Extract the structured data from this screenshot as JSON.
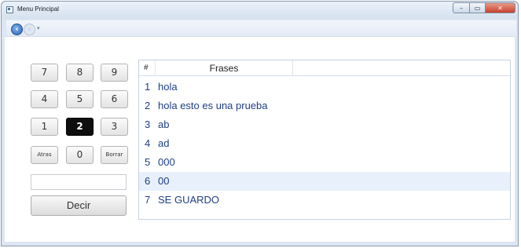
{
  "window": {
    "title": "Menu Principal",
    "controls": {
      "minimize": "–",
      "maximize": "▭",
      "close": "✕"
    }
  },
  "nav": {
    "back_icon": "back-arrow-icon",
    "forward_icon": "forward-arrow-icon",
    "dropdown": "▾"
  },
  "keypad": {
    "keys": [
      "7",
      "8",
      "9",
      "4",
      "5",
      "6",
      "1",
      "2",
      "3",
      "Atras",
      "0",
      "Borrar"
    ],
    "active_key": "2"
  },
  "input": {
    "value": ""
  },
  "decir_button": {
    "label": "Decir"
  },
  "table": {
    "headers": [
      "#",
      "Frases"
    ],
    "selected_row": 6,
    "rows": [
      {
        "num": "1",
        "text": "hola"
      },
      {
        "num": "2",
        "text": "hola esto es una prueba"
      },
      {
        "num": "3",
        "text": "ab"
      },
      {
        "num": "4",
        "text": "ad"
      },
      {
        "num": "5",
        "text": "000"
      },
      {
        "num": "6",
        "text": "00"
      },
      {
        "num": "7",
        "text": "SE GUARDO"
      }
    ]
  }
}
